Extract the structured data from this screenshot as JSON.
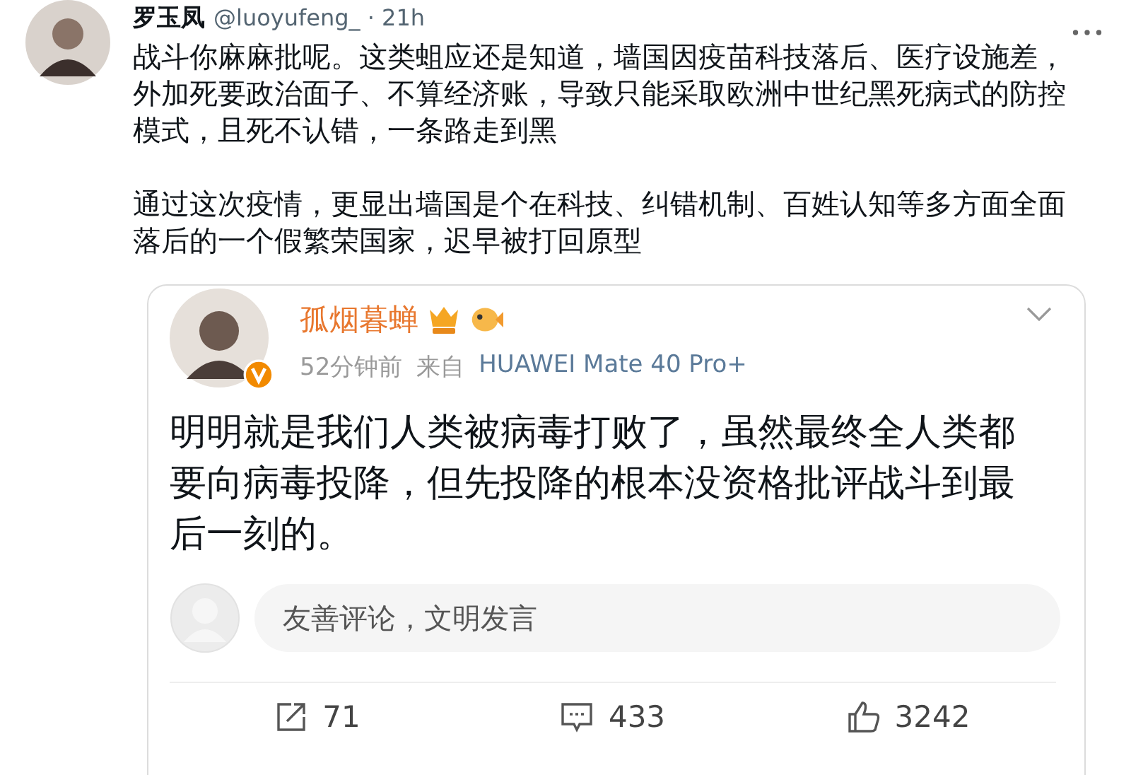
{
  "tweet": {
    "author_name": "罗玉凤",
    "meta": "@luoyufeng_ · 21h",
    "paragraphs": [
      "战斗你麻麻批呢。这类蛆应还是知道，墙国因疫苗科技落后、医疗设施差，外加死要政治面子、不算经济账，导致只能采取欧洲中世纪黑死病式的防控模式，且死不认错，一条路走到黑",
      "通过这次疫情，更显出墙国是个在科技、纠错机制、百姓认知等多方面全面落后的一个假繁荣国家，迟早被打回原型"
    ]
  },
  "quoted_post": {
    "author_name": "孤烟暮蝉",
    "verified": true,
    "time_ago": "52分钟前",
    "source_prefix": "来自",
    "source": "HUAWEI Mate 40 Pro+",
    "body": "明明就是我们人类被病毒打败了，虽然最终全人类都要向病毒投降，但先投降的根本没资格批评战斗到最后一刻的。",
    "comment_field": {
      "placeholder": "友善评论，文明发言"
    },
    "actions": [
      {
        "kind": "repost",
        "count": "71"
      },
      {
        "kind": "comment",
        "count": "433"
      },
      {
        "kind": "like",
        "count": "3242"
      }
    ]
  }
}
